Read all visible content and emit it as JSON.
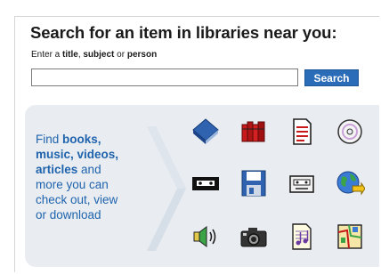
{
  "search": {
    "title": "Search for an item in libraries near you:",
    "hint_prefix": "Enter a ",
    "hint_term1": "title",
    "hint_sep": ", ",
    "hint_term2": "subject",
    "hint_or": " or ",
    "hint_term3": "person",
    "input_value": "",
    "button_label": "Search"
  },
  "panel": {
    "blurb_find": "Find ",
    "blurb_b1": "books,",
    "blurb_b2": "music, videos,",
    "blurb_b3": "articles",
    "blurb_rest1": " and",
    "blurb_rest2": "more you can",
    "blurb_rest3": "check out, view",
    "blurb_rest4": "or download",
    "icons": [
      "book-icon",
      "books-shelf-icon",
      "document-icon",
      "cd-icon",
      "videotape-icon",
      "floppy-disk-icon",
      "cassette-icon",
      "internet-globe-icon",
      "speaker-audio-icon",
      "camera-icon",
      "sheet-music-icon",
      "map-icon"
    ]
  },
  "colors": {
    "accent_blue": "#2a6cb8",
    "blurb_blue": "#1f63ad",
    "panel_bg": "#e9edf1"
  }
}
